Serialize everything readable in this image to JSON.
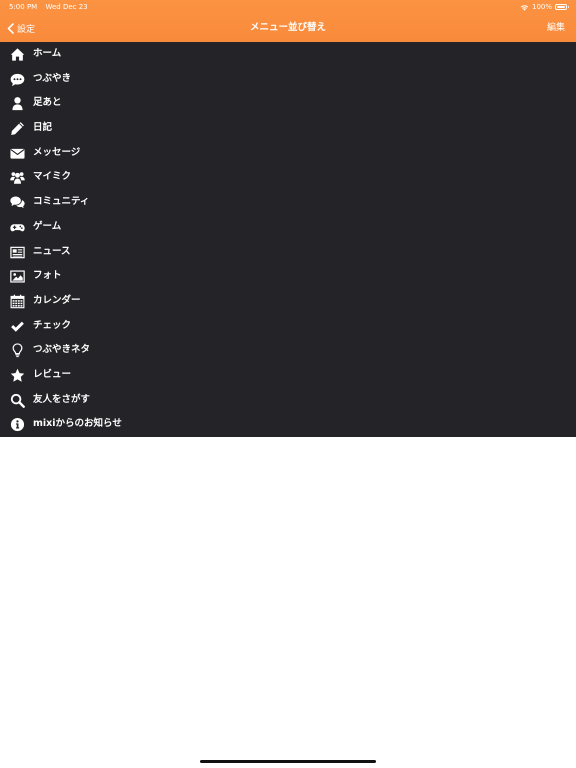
{
  "status_bar": {
    "time": "5:00 PM",
    "date": "Wed Dec 23",
    "battery": "100%"
  },
  "nav": {
    "back_label": "設定",
    "title": "メニュー並び替え",
    "edit_label": "編集"
  },
  "theme": {
    "nav_color": "#f98a3c",
    "menu_bg": "#242428",
    "text_color": "#ffffff"
  },
  "menu": {
    "items": [
      {
        "label": "ホーム",
        "icon": "home-icon"
      },
      {
        "label": "つぶやき",
        "icon": "speech-bubble-icon"
      },
      {
        "label": "足あと",
        "icon": "user-icon"
      },
      {
        "label": "日記",
        "icon": "pencil-icon"
      },
      {
        "label": "メッセージ",
        "icon": "envelope-icon"
      },
      {
        "label": "マイミク",
        "icon": "group-icon"
      },
      {
        "label": "コミュニティ",
        "icon": "comments-icon"
      },
      {
        "label": "ゲーム",
        "icon": "gamepad-icon"
      },
      {
        "label": "ニュース",
        "icon": "newspaper-icon"
      },
      {
        "label": "フォト",
        "icon": "photo-icon"
      },
      {
        "label": "カレンダー",
        "icon": "calendar-icon"
      },
      {
        "label": "チェック",
        "icon": "check-icon"
      },
      {
        "label": "つぶやきネタ",
        "icon": "lightbulb-icon"
      },
      {
        "label": "レビュー",
        "icon": "star-icon"
      },
      {
        "label": "友人をさがす",
        "icon": "search-icon"
      },
      {
        "label": "mixiからのお知らせ",
        "icon": "info-icon"
      }
    ]
  }
}
